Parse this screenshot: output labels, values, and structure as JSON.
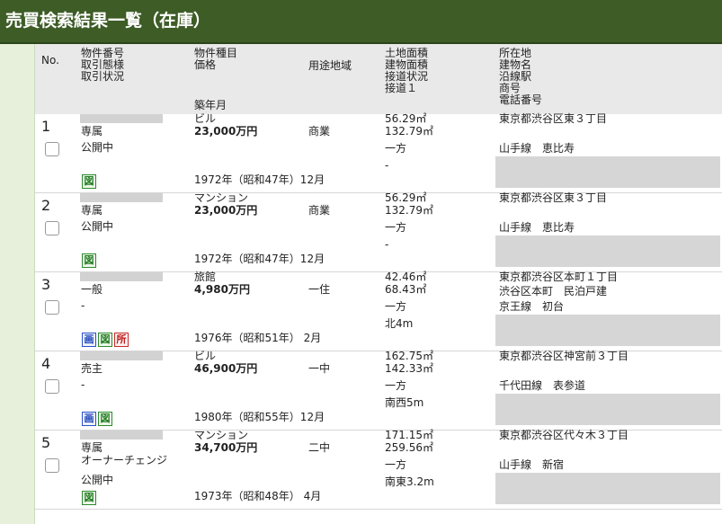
{
  "page_title": "売買検索結果一覧（在庫）",
  "header": {
    "col_no": "No.",
    "col_a": [
      "物件番号",
      "取引態様",
      "取引状況"
    ],
    "col_b": [
      "物件種目",
      "価格"
    ],
    "col_b_bottom": "築年月",
    "col_c": "用途地域",
    "col_d": [
      "土地面積",
      "建物面積",
      "接道状況",
      "接道１"
    ],
    "col_e": [
      "所在地",
      "建物名",
      "沿線駅",
      "商号",
      "電話番号"
    ]
  },
  "icon_labels": {
    "ga": "画",
    "zu": "図",
    "sho": "所"
  },
  "rows": [
    {
      "no": "1",
      "a1": "専属",
      "a2": "公開中",
      "type": "ビル",
      "price": "23,000万円",
      "zone": "商業",
      "land": "56.29㎡",
      "bldg": "132.79㎡",
      "road": "一方",
      "road1": "-",
      "built": "1972年（昭和47年）12月",
      "addr": "東京都渋谷区東３丁目",
      "name": "",
      "station": "山手線　恵比寿",
      "icons": [
        "zu"
      ]
    },
    {
      "no": "2",
      "a1": "専属",
      "a2": "公開中",
      "type": "マンション",
      "price": "23,000万円",
      "zone": "商業",
      "land": "56.29㎡",
      "bldg": "132.79㎡",
      "road": "一方",
      "road1": "-",
      "built": "1972年（昭和47年）12月",
      "addr": "東京都渋谷区東３丁目",
      "name": "",
      "station": "山手線　恵比寿",
      "icons": [
        "zu"
      ]
    },
    {
      "no": "3",
      "a1": "一般",
      "a2": "-",
      "type": "旅館",
      "price": "4,980万円",
      "zone": "一住",
      "land": "42.46㎡",
      "bldg": "68.43㎡",
      "road": "一方",
      "road1": "北4m",
      "built": "1976年（昭和51年） 2月",
      "addr": "東京都渋谷区本町１丁目",
      "name": "渋谷区本町　民泊戸建",
      "station": "京王線　初台",
      "icons": [
        "ga",
        "zu",
        "sho"
      ]
    },
    {
      "no": "4",
      "a1": "売主",
      "a2": "-",
      "type": "ビル",
      "price": "46,900万円",
      "zone": "一中",
      "land": "162.75㎡",
      "bldg": "142.33㎡",
      "road": "一方",
      "road1": "南西5m",
      "built": "1980年（昭和55年）12月",
      "addr": "東京都渋谷区神宮前３丁目",
      "name": "",
      "station": "千代田線　表参道",
      "icons": [
        "ga",
        "zu"
      ]
    },
    {
      "no": "5",
      "a1": "専属",
      "a1b": "オーナーチェンジ",
      "a2": "公開中",
      "type": "マンション",
      "price": "34,700万円",
      "zone": "二中",
      "land": "171.15㎡",
      "bldg": "259.56㎡",
      "road": "一方",
      "road1": "南東3.2m",
      "built": "1973年（昭和48年） 4月",
      "addr": "東京都渋谷区代々木３丁目",
      "name": "",
      "station": "山手線　新宿",
      "icons": [
        "zu"
      ]
    }
  ]
}
